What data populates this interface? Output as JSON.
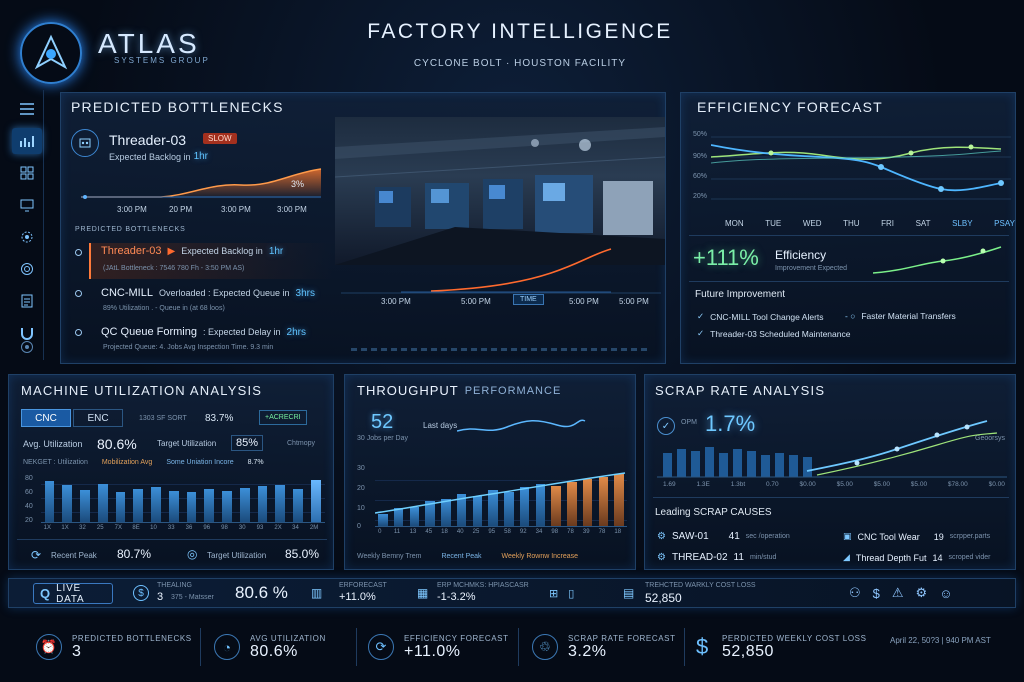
{
  "brand": {
    "name": "ATLAS",
    "sub": "SYSTEMS GROUP"
  },
  "header": {
    "title": "FACTORY INTELLIGENCE",
    "subtitle": "CYCLONE BOLT · HOUSTON FACILITY"
  },
  "sidebar": {
    "icons": [
      "menu-icon",
      "analytics-icon",
      "grid-icon",
      "monitor-icon",
      "settings-icon",
      "gear-icon",
      "report-icon",
      "magnet-icon",
      "target-icon"
    ],
    "active_index": 1
  },
  "bottlenecks": {
    "title": "PREDICTED BOTTLENECKS",
    "featured": {
      "name": "Threader-03",
      "badge": "SLOW",
      "desc": "Expected Backlog in",
      "desc_value": "1hr",
      "chart_pct": "3%",
      "times": [
        "3:00 PM",
        "20 PM",
        "3:00 PM",
        "3:00 PM"
      ]
    },
    "list_label": "PREDICTED BOTTLENECKS",
    "items": [
      {
        "name": "Threader-03",
        "desc": "Expected Backlog in",
        "value": "1hr",
        "sub": "(JAtL Bottleneck : 7546 780   Fh - 3:50 PM AS)"
      },
      {
        "name": "CNC-MILL",
        "desc": "Overloaded : Expected Queue in",
        "value": "3hrs",
        "sub": "89% Utilization . - Queue in (at 68 loos)"
      },
      {
        "name": "QC Queue Forming",
        "desc": ": Expected Delay in",
        "value": "2hrs",
        "sub": "Projected Queue:  4. Jobs   Avg Inspection Time. 9.3 min"
      }
    ],
    "timeline": [
      "3:00 PM",
      "5:00 PM",
      "5:00 PM",
      "5:00 PM"
    ],
    "timeline_tag": "TIME"
  },
  "efficiency": {
    "title": "EFFICIENCY FORECAST",
    "y_ticks": [
      "50%",
      "90%",
      "60%",
      "20%"
    ],
    "days": [
      "MON",
      "TUE",
      "WED",
      "THU",
      "FRI",
      "SAT",
      "SLBY",
      "PSAY"
    ],
    "big": "+111%",
    "big_label": "Efficiency",
    "big_sub": "Improvement Expected",
    "future_title": "Future Improvement",
    "future_items": [
      "CNC-MILL Tool Change Alerts",
      "Faster Material Transfers",
      "Threader-03 Scheduled Maintenance"
    ]
  },
  "utilization": {
    "title": "MACHINE UTILIZATION ANALYSIS",
    "tabs": [
      "CNC",
      "ENC"
    ],
    "tab_info": "1303 SF SORT",
    "tab_pct": "83.7%",
    "tab_badge": "+ACRECRI",
    "avg_label": "Avg. Utilization",
    "avg_value": "80.6%",
    "target_label": "Target Utilization",
    "target_value": "85%",
    "right_label": "Chtmopy",
    "legend": [
      "NEKGET : Utilization",
      "Mobilization Avg",
      "Some Uniation Incore",
      "8.7%"
    ],
    "y_ticks": [
      "80",
      "60",
      "40",
      "20"
    ],
    "bars": [
      0.8,
      0.72,
      0.62,
      0.74,
      0.58,
      0.65,
      0.68,
      0.6,
      0.58,
      0.64,
      0.61,
      0.66,
      0.7,
      0.73,
      0.64,
      0.82
    ],
    "x_labels": [
      "1X",
      "1X",
      "32",
      "25",
      "7X",
      "8E",
      "10",
      "33",
      "36",
      "96",
      "98",
      "30",
      "93",
      "2X",
      "34",
      "2M"
    ],
    "peak_label": "Recent Peak",
    "peak_value": "80.7%",
    "target2_label": "Target Utilization",
    "target2_value": "85.0%"
  },
  "throughput": {
    "title": "THROUGHPUT",
    "title2": "PERFORMANCE",
    "value": "52",
    "value_sub": "30 Jobs per Day",
    "spark_label": "Last days",
    "y_ticks": [
      "30",
      "20",
      "10",
      "0"
    ],
    "bars": [
      0.18,
      0.28,
      0.3,
      0.38,
      0.42,
      0.5,
      0.46,
      0.55,
      0.52,
      0.6,
      0.65,
      0.62,
      0.68,
      0.72,
      0.75,
      0.8
    ],
    "x_labels": [
      "0",
      "11",
      "13",
      "45",
      "18",
      "40",
      "25",
      "95",
      "58",
      "92",
      "34",
      "98",
      "78",
      "39",
      "78",
      "18"
    ],
    "legend": [
      "Weekly Bemny Trem",
      "Recent Peak",
      "Weekly Rownw Increase"
    ]
  },
  "scrap": {
    "title": "SCRAP RATE ANALYSIS",
    "small_label": "OPM",
    "value": "1.7%",
    "right_label": "Geoorsys",
    "x_labels": [
      "1.69",
      "1.3E",
      "1.3bt",
      "0.70",
      "$0.00",
      "$5.00",
      "$5.00",
      "$5.00",
      "$78.00",
      "$0.00"
    ],
    "causes_title": "Leading SCRAP CAUSES",
    "causes": [
      {
        "name": "SAW-01",
        "value": "41",
        "unit": "sec /operation"
      },
      {
        "name": "THREAD-02",
        "value": "11",
        "unit": "min/stud"
      },
      {
        "name": "CNC Tool Wear",
        "value": "19",
        "unit": "scrpper.parts"
      },
      {
        "name": "Thread Depth Fut",
        "value": "14",
        "unit": "scroped vider"
      }
    ]
  },
  "ticker": {
    "live": "LIVE DATA",
    "items": [
      {
        "label": "THEALING",
        "value": "3",
        "extra": "375 - Matsser"
      },
      {
        "label": "",
        "value": "80.6 %",
        "extra": ""
      },
      {
        "label": "ERFORECAST",
        "value": "+11.0%",
        "extra": ""
      },
      {
        "label": "ERP MCHMKS: HPIASCASR",
        "value": "-1-3.2%",
        "extra": ""
      },
      {
        "label": "TREHCTED WARKLY COST LOSS",
        "value": "52,850",
        "extra": ""
      }
    ]
  },
  "kpis": [
    {
      "label": "PREDICTED BOTTLENECKS",
      "value": "3",
      "icon": "alarm-icon"
    },
    {
      "label": "AVG UTILIZATION",
      "value": "80.6%",
      "icon": "gauge-icon"
    },
    {
      "label": "EFFICIENCY FORECAST",
      "value": "+11.0%",
      "icon": "sync-icon"
    },
    {
      "label": "SCRAP RATE FORECAST",
      "value": "3.2%",
      "icon": "recycle-icon"
    },
    {
      "label": "PERDICTED WEEKLY COST LOSS",
      "value": "52,850",
      "icon": "dollar-icon"
    }
  ],
  "timestamp": "April 22, 50?3 | 940 PM AST"
}
